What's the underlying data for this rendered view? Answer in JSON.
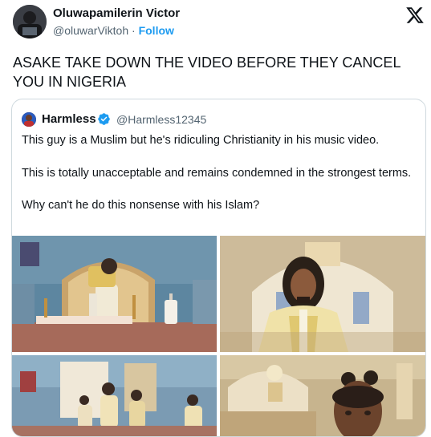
{
  "author": {
    "name": "Oluwapamilerin Victor",
    "handle": "@oluwarViktoh",
    "separator": "·",
    "follow_label": "Follow"
  },
  "logo_icon": "x-logo-icon",
  "tweet": {
    "text": "ASAKE TAKE DOWN THE VIDEO BEFORE THEY CANCEL YOU IN NIGERIA"
  },
  "quoted": {
    "name": "Harmless",
    "handle": "@Harmless12345",
    "verified_color": "#1d9bf0",
    "paragraphs": [
      "This guy is a Muslim but he's ridiculing Christianity in his music video.",
      "This is totally unacceptable and remains condemned in the strongest terms.",
      "Why can't he do this nonsense with his Islam?"
    ]
  },
  "colors": {
    "link": "#1d9bf0",
    "text": "#0f1419",
    "secondary": "#536471",
    "border": "#cfd9de"
  }
}
